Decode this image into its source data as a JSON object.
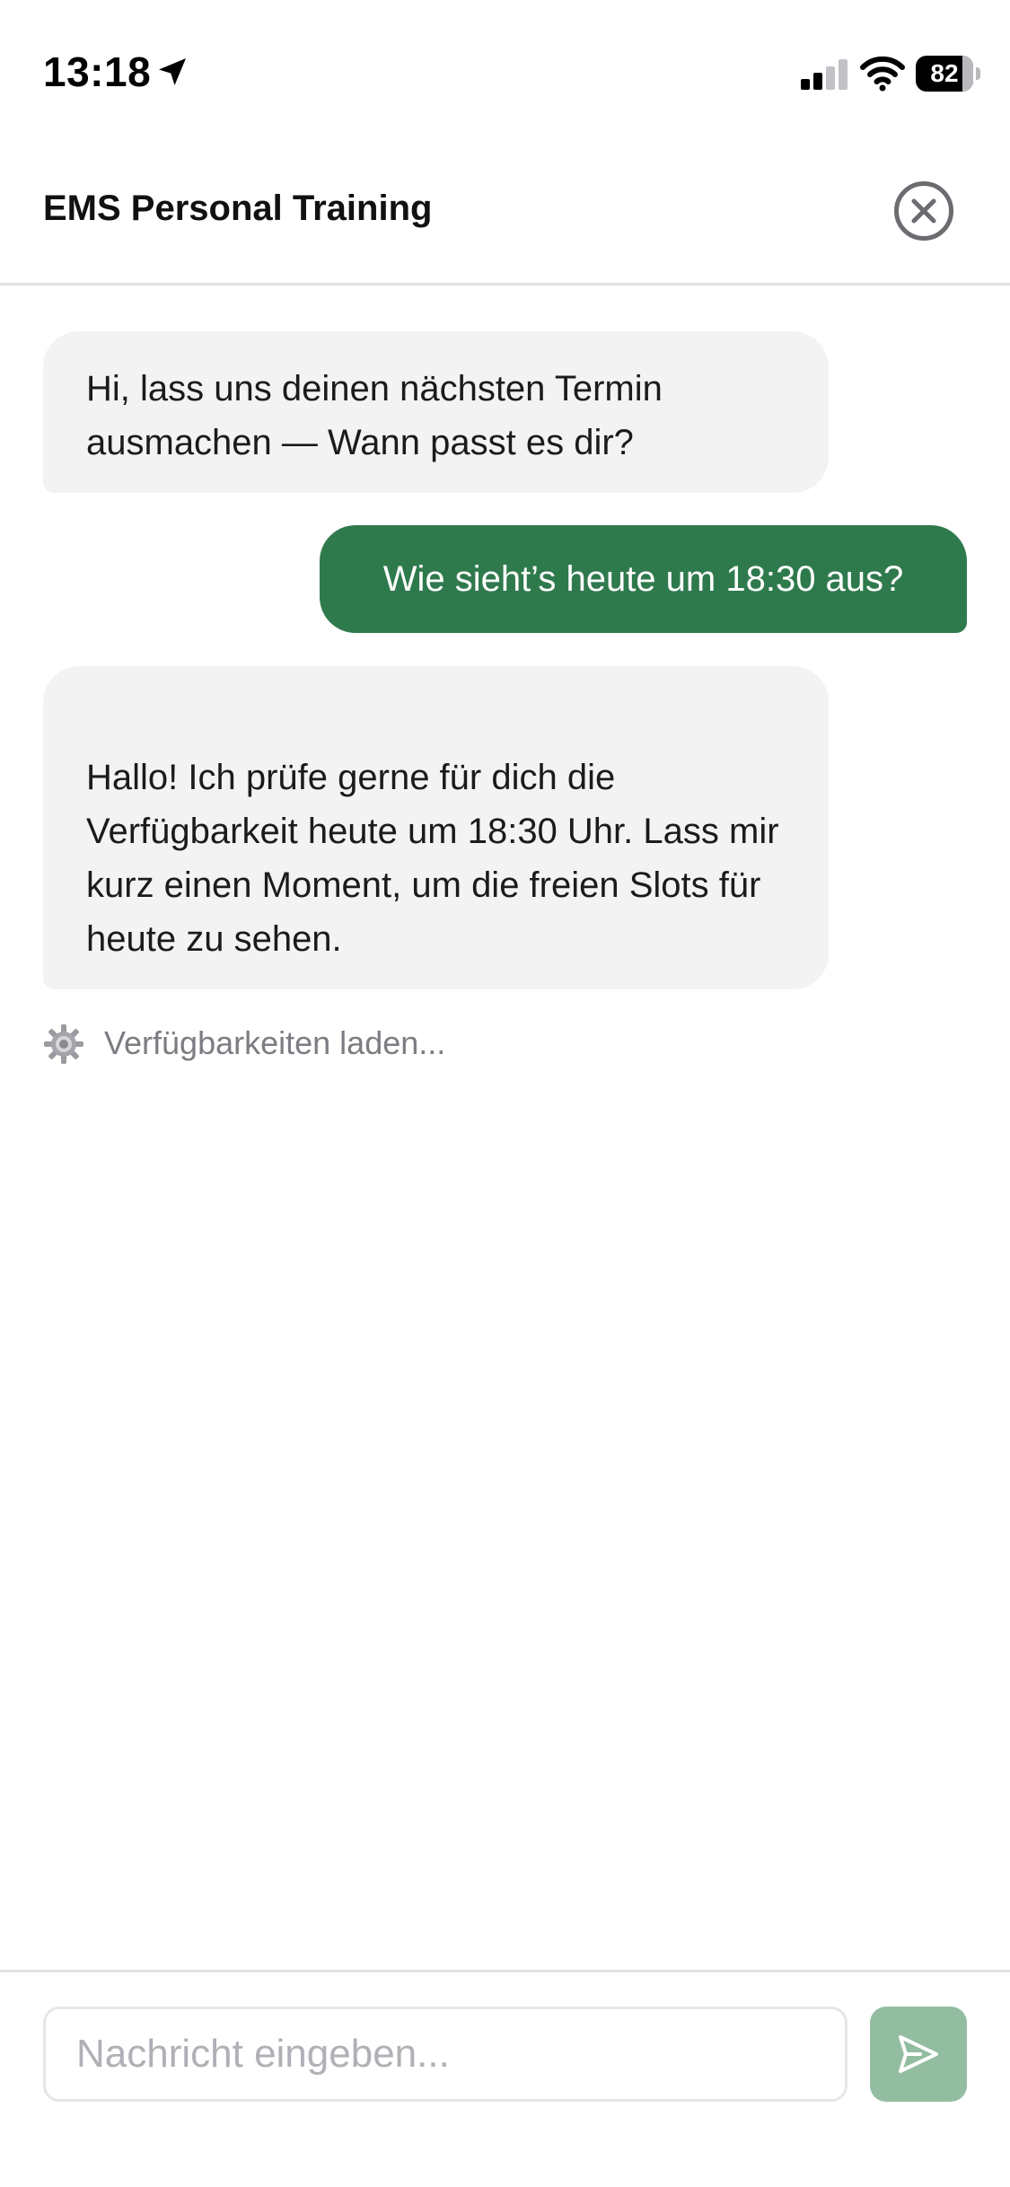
{
  "status_bar": {
    "time": "13:18",
    "battery_percent": "82",
    "battery_level": 0.82,
    "icons": [
      "location-arrow-icon",
      "cellular-signal-icon",
      "wifi-icon",
      "battery-icon"
    ]
  },
  "header": {
    "title": "EMS Personal Training",
    "close_icon": "close-icon"
  },
  "messages": [
    {
      "sender": "assistant",
      "text": "Hi, lass uns deinen nächsten Termin ausmachen — Wann passt es dir?"
    },
    {
      "sender": "user",
      "text": "Wie sieht’s heute um 18:30 aus?"
    },
    {
      "sender": "assistant",
      "text": "Hallo! Ich prüfe gerne für dich die Verfügbarkeit heute um 18:30 Uhr. Lass mir kurz einen Moment, um die freien Slots für heute zu sehen."
    }
  ],
  "loading": {
    "icon": "gear-icon",
    "text": "Verfügbarkeiten laden..."
  },
  "composer": {
    "placeholder": "Nachricht eingeben...",
    "value": "",
    "send_icon": "send-icon"
  },
  "colors": {
    "user_bubble": "#2f7a4d",
    "assistant_bubble": "#f3f3f4",
    "send_button": "#93bda1"
  }
}
